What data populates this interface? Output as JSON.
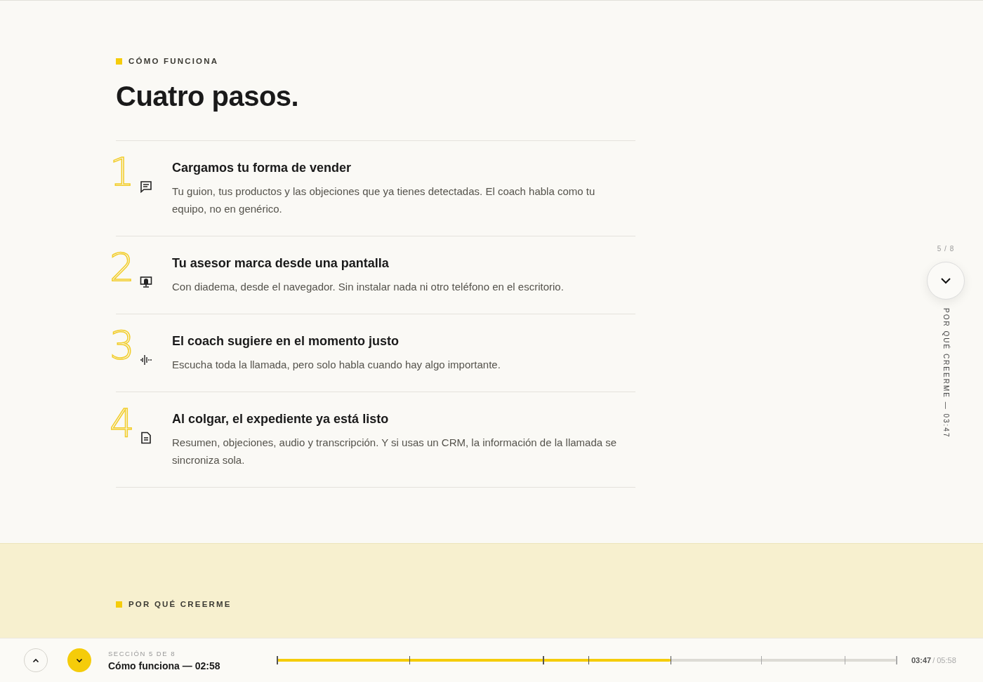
{
  "section": {
    "eyebrow": "CÓMO FUNCIONA",
    "title": "Cuatro pasos.",
    "steps": [
      {
        "number": "1",
        "kind": "chat",
        "title": "Cargamos tu forma de vender",
        "text": "Tu guion, tus productos y las objeciones que ya tienes detectadas. El coach habla como tu equipo, no en genérico."
      },
      {
        "number": "2",
        "kind": "monitor",
        "title": "Tu asesor marca desde una pantalla",
        "text": "Con diadema, desde el navegador. Sin instalar nada ni otro teléfono en el escritorio."
      },
      {
        "number": "3",
        "kind": "wave",
        "title": "El coach sugiere en el momento justo",
        "text": "Escucha toda la llamada, pero solo habla cuando hay algo importante."
      },
      {
        "number": "4",
        "kind": "doc",
        "title": "Al colgar, el expediente ya está listo",
        "text": "Resumen, objeciones, audio y transcripción. Y si usas un CRM, la información de la llamada se sincroniza sola."
      }
    ]
  },
  "next_section": {
    "eyebrow": "POR QUÉ CREERME"
  },
  "side_rail": {
    "counter": "5 / 8",
    "next_label": "POR QUÉ CREERME — 03:47"
  },
  "player": {
    "section_label": "SECCIÓN 5 DE 8",
    "current": "Cómo funciona — 02:58",
    "level": 0.636,
    "elapsed": "03:47",
    "total": "/ 05:58"
  }
}
